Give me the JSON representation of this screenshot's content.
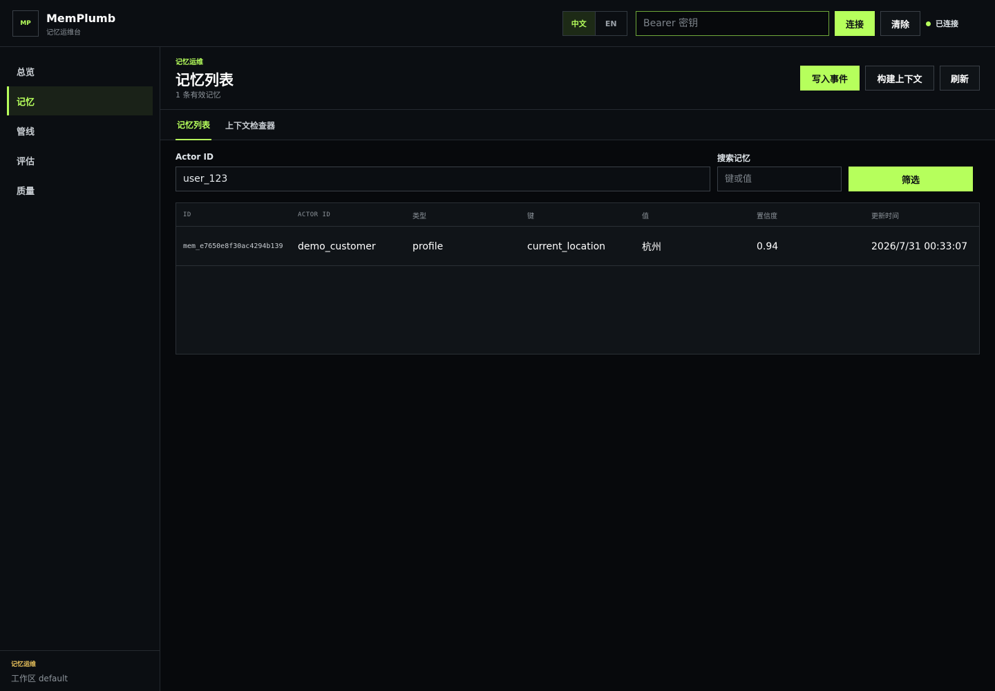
{
  "header": {
    "logo_text": "MP",
    "app_name": "MemPlumb",
    "app_subtitle": "记忆运维台",
    "lang_options": [
      "中文",
      "EN"
    ],
    "token_placeholder": "Bearer 密钥",
    "connect_label": "连接",
    "clear_label": "清除",
    "status_text": "已连接",
    "status_color": "#b6ff5c"
  },
  "sidebar": {
    "items": [
      {
        "label": "总览",
        "active": false
      },
      {
        "label": "记忆",
        "active": true
      },
      {
        "label": "管线",
        "active": false
      },
      {
        "label": "评估",
        "active": false
      },
      {
        "label": "质量",
        "active": false
      }
    ],
    "footer_tag": "记忆运维",
    "footer_workspace": "工作区 default"
  },
  "page": {
    "breadcrumb": "记忆运维",
    "title": "记忆列表",
    "count_text": "1 条有效记忆",
    "actions": {
      "write_event": "写入事件",
      "build_context": "构建上下文",
      "refresh": "刷新"
    }
  },
  "tabs": [
    {
      "label": "记忆列表",
      "active": true
    },
    {
      "label": "上下文检查器",
      "active": false
    }
  ],
  "filters": {
    "actor_label": "Actor ID",
    "actor_value": "user_123",
    "search_label": "搜索记忆",
    "search_placeholder": "键或值",
    "filter_button": "筛选"
  },
  "table": {
    "columns": [
      "ID",
      "ACTOR ID",
      "类型",
      "键",
      "值",
      "置信度",
      "更新时间"
    ],
    "rows": [
      {
        "id": "mem_e7650e8f30ac4294b139",
        "actor_id": "demo_customer",
        "type": "profile",
        "key": "current_location",
        "value": "杭州",
        "confidence": "0.94",
        "updated_at": "2026/7/31 00:33:07"
      }
    ]
  },
  "colors": {
    "accent": "#b6ff5c",
    "background": "#07090c",
    "panel": "#0b0e12",
    "warning_tag": "#e8c15c"
  }
}
